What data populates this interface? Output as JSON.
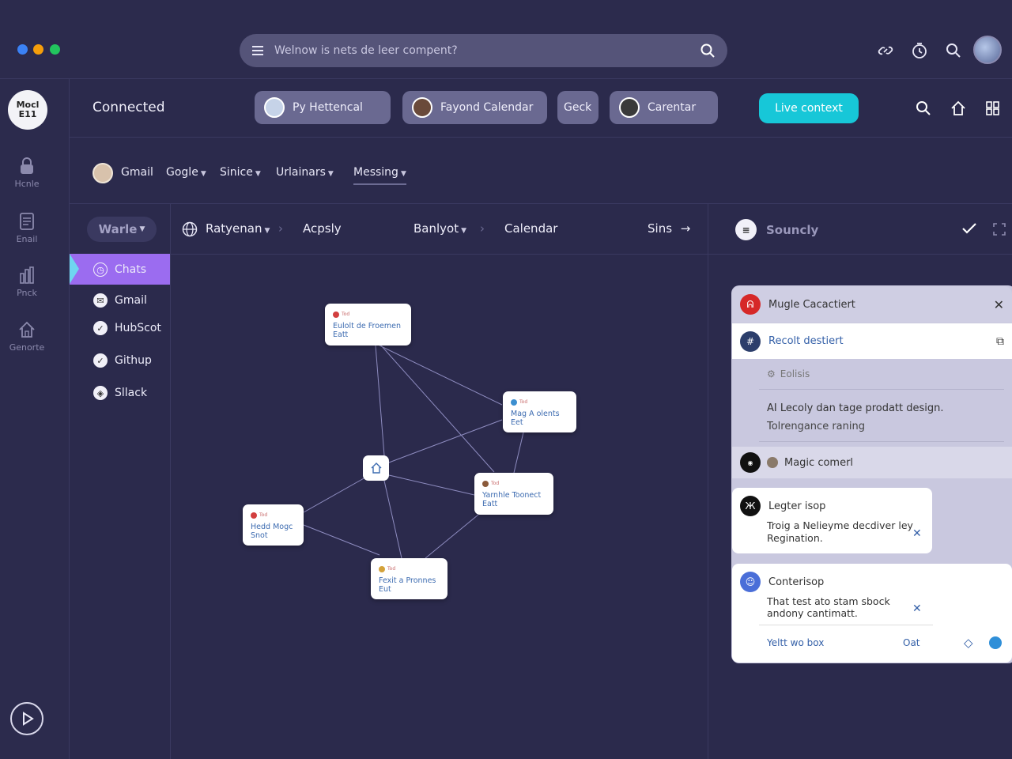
{
  "window": {
    "dots": [
      "#3b82f6",
      "#f59e0b",
      "#22c55e"
    ]
  },
  "search": {
    "placeholder": "Welnow is nets de leer compent?"
  },
  "top_icons": [
    "link-icon",
    "timer-icon",
    "search-icon",
    "user-avatar"
  ],
  "rail": {
    "logo": "Mocl E11",
    "items": [
      {
        "label": "Hcnle",
        "icon": "lock-icon"
      },
      {
        "label": "Enail",
        "icon": "document-icon"
      },
      {
        "label": "Pnck",
        "icon": "chart-icon"
      },
      {
        "label": "Genorte",
        "icon": "home-icon"
      }
    ]
  },
  "header": {
    "title": "Connected",
    "pills": [
      "Py Hettencal",
      "Fayond Calendar",
      "Geck",
      "Carentar"
    ],
    "live_button": "Live context"
  },
  "filters": {
    "items": [
      "Gmail",
      "Gogle",
      "Sinice",
      "Urlainars",
      "Messing"
    ]
  },
  "breadcrumbs": {
    "warle": "Warle",
    "items": [
      "Ratyenan",
      "Acpsly",
      "Banlyot",
      "Calendar",
      "Sins"
    ]
  },
  "sidebar": {
    "items": [
      "Chats",
      "Gmail",
      "HubScot",
      "Githup",
      "Sllack"
    ]
  },
  "graph": {
    "nodes": [
      {
        "tag": "Tod",
        "text": "Eulolt de Froemen Eatt"
      },
      {
        "tag": "Tod",
        "text": "Mag A olents Eet"
      },
      {
        "tag": "Tod",
        "text": "Yarnhle Toonect Eatt"
      },
      {
        "tag": "Tod",
        "text": "Hedd Mogc Snot"
      },
      {
        "tag": "Tod",
        "text": "Fexit a Pronnes Eut"
      }
    ]
  },
  "right_panel": {
    "title": "Souncly",
    "cards": {
      "header": "Mugle Cacactiert",
      "recolt": "Recolt destiert",
      "eolisis": "Eolisis",
      "body1": "AI Lecoly dan tage prodatt design.",
      "body2": "Tolrengance raning",
      "magic": "Magic comerl",
      "legter_title": "Legter isop",
      "legter_body": "Troig a Nelieyme decdiver ley Regination.",
      "conter_title": "Conterisop",
      "conter_body": "That test ato stam sbock andony cantimatt.",
      "footer_left": "Yeltt wo box",
      "footer_right": "Oat"
    }
  },
  "colors": {
    "accent": "#17c7d8",
    "selected": "#9b6cf0",
    "bg": "#2b2a4c"
  }
}
